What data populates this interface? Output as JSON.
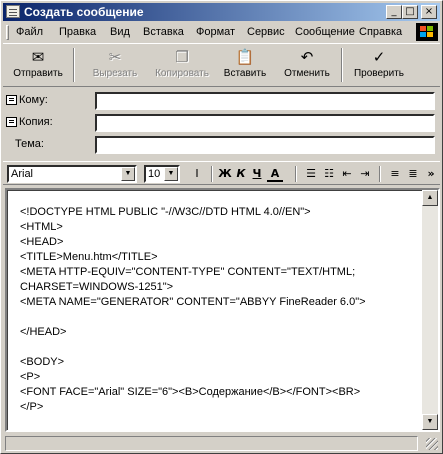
{
  "window": {
    "title": "Создать сообщение",
    "minimize": "_",
    "maximize": "□",
    "close": "×"
  },
  "menu": [
    "Файл",
    "Правка",
    "Вид",
    "Вставка",
    "Формат",
    "Сервис",
    "Сообщение",
    "Справка"
  ],
  "toolbar": {
    "send": "Отправить",
    "cut": "Вырезать",
    "copy": "Копировать",
    "paste": "Вставить",
    "undo": "Отменить",
    "check": "Проверить"
  },
  "icons": {
    "send": "send-icon",
    "cut": "scissors-icon",
    "copy": "copy-icon",
    "paste": "paste-icon",
    "undo": "undo-icon",
    "check": "spellcheck-icon"
  },
  "fields": {
    "to_label": "Кому:",
    "cc_label": "Копия:",
    "subject_label": "Тема:",
    "to_value": "",
    "cc_value": "",
    "subject_value": ""
  },
  "format": {
    "font": "Arial",
    "size": "10",
    "bold": "Ж",
    "italic": "К",
    "underline": "Ч",
    "font_color": "A",
    "more": "»"
  },
  "body_lines": [
    "<!DOCTYPE HTML PUBLIC \"-//W3C//DTD HTML 4.0//EN\">",
    "<HTML>",
    "<HEAD>",
    "<TITLE>Menu.htm</TITLE>",
    "<META HTTP-EQUIV=\"CONTENT-TYPE\" CONTENT=\"TEXT/HTML;",
    "CHARSET=WINDOWS-1251\">",
    "<META NAME=\"GENERATOR\" CONTENT=\"ABBYY FineReader 6.0\">",
    "",
    "</HEAD>",
    "",
    "<BODY>",
    "<P>",
    "<FONT FACE=\"Arial\" SIZE=\"6\"><B>Содержание</B></FONT><BR>",
    "</P>"
  ],
  "colors": {
    "titlebar_start": "#0a246a",
    "titlebar_end": "#a6caf0",
    "face": "#d4d0c8"
  }
}
